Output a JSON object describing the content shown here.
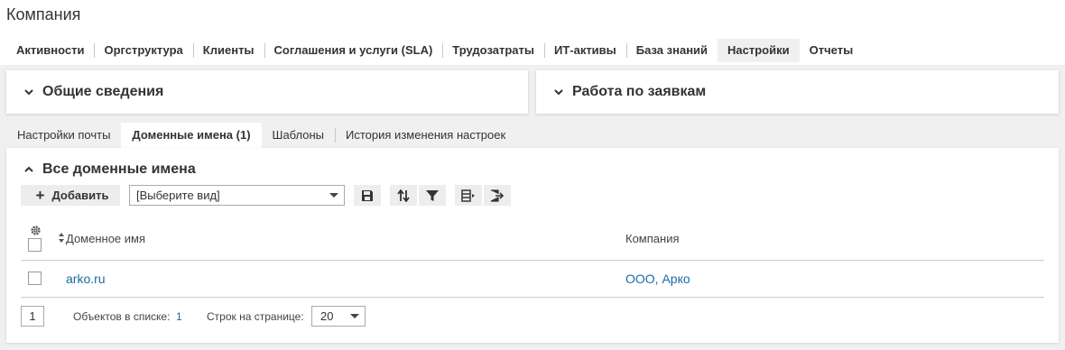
{
  "page": {
    "title": "Компания"
  },
  "main_tabs": [
    {
      "label": "Активности",
      "active": false
    },
    {
      "label": "Оргструктура",
      "active": false
    },
    {
      "label": "Клиенты",
      "active": false
    },
    {
      "label": "Соглашения и услуги (SLA)",
      "active": false
    },
    {
      "label": "Трудозатраты",
      "active": false
    },
    {
      "label": "ИТ-активы",
      "active": false
    },
    {
      "label": "База знаний",
      "active": false
    },
    {
      "label": "Настройки",
      "active": true
    },
    {
      "label": "Отчеты",
      "active": false
    }
  ],
  "cards": {
    "general": {
      "title": "Общие сведения",
      "icon": "chevron-down-icon"
    },
    "requests": {
      "title": "Работа по заявкам",
      "icon": "chevron-down-icon"
    }
  },
  "sub_tabs": [
    {
      "label": "Настройки почты",
      "active": false
    },
    {
      "label": "Доменные имена (1)",
      "active": true
    },
    {
      "label": "Шаблоны",
      "active": false
    },
    {
      "label": "История изменения настроек",
      "active": false
    }
  ],
  "section": {
    "title": "Все доменные имена",
    "icon": "chevron-up-icon"
  },
  "toolbar": {
    "add_label": "Добавить",
    "view_select_value": "[Выберите вид]",
    "icons": [
      "save-icon",
      "sort-icon",
      "filter-icon",
      "columns-icon",
      "export-icon"
    ]
  },
  "grid": {
    "columns": [
      "Доменное имя",
      "Компания"
    ],
    "rows": [
      {
        "domain": "arko.ru",
        "company": "ООО, Арко"
      }
    ]
  },
  "pager": {
    "current_page": "1",
    "objects_label": "Объектов в списке:",
    "objects_count": "1",
    "rows_label": "Строк на странице:",
    "rows_value": "20"
  },
  "colors": {
    "link": "#1a6aa5",
    "background": "#f0f0f0",
    "button_bg": "#ededed"
  }
}
